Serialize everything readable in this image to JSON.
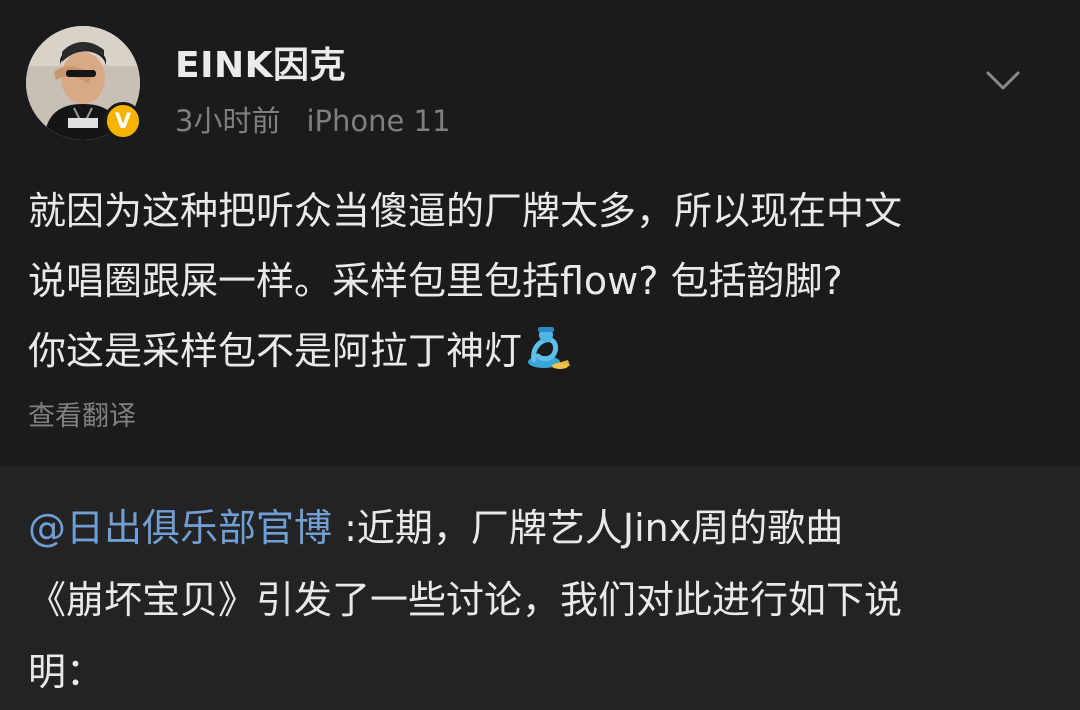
{
  "post": {
    "username": "EINK因克",
    "time": "3小时前",
    "device": "iPhone 11",
    "verified_mark": "V",
    "content_lines": [
      "就因为这种把听众当傻逼的厂牌太多，所以现在中文",
      "说唱圈跟屎一样。采样包里包括flow? 包括韵脚?",
      "你这是采样包不是阿拉丁神灯"
    ],
    "emoji_icon": "genie-icon",
    "translate_label": "查看翻译"
  },
  "repost": {
    "mention": "@日出俱乐部官博",
    "lines": [
      " :近期，厂牌艺人Jinx周的歌曲",
      "《崩坏宝贝》引发了一些讨论，我们对此进行如下说",
      "明："
    ]
  },
  "colors": {
    "background": "#1b1b1b",
    "repost_background": "#232323",
    "mention": "#6f9fd6",
    "verified": "#f4b400"
  }
}
